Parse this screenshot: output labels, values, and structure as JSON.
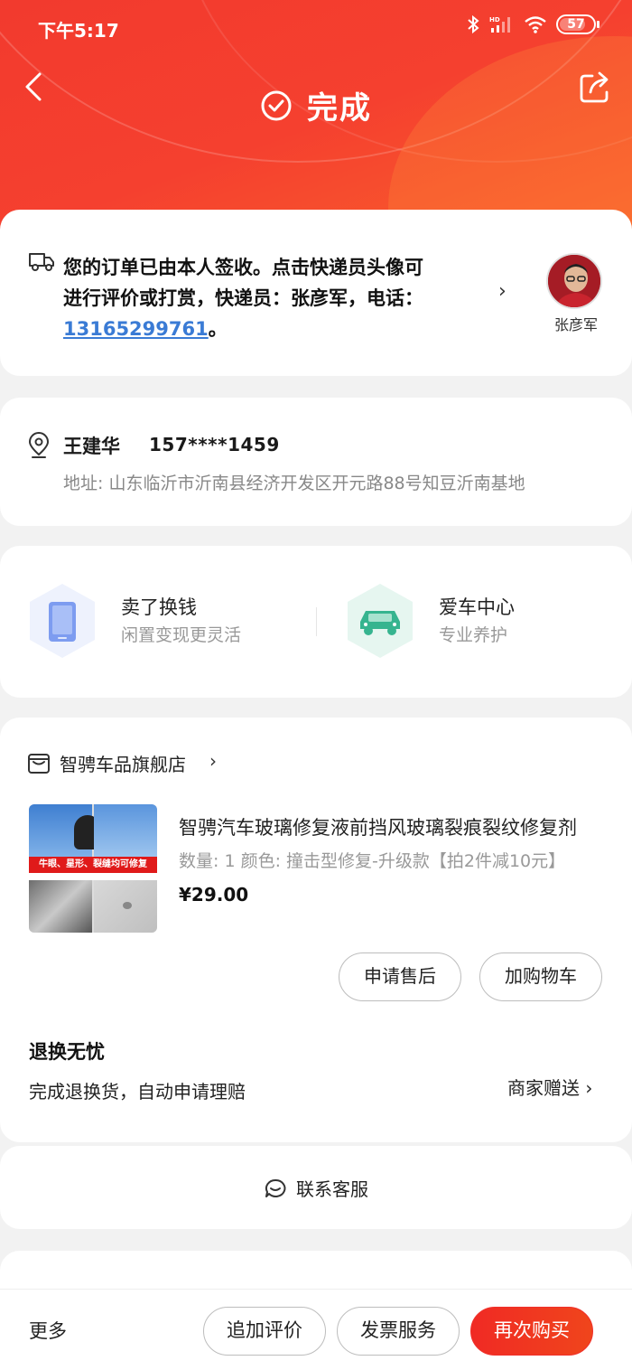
{
  "status_bar": {
    "time": "下午5:17",
    "battery": "57",
    "network": "HD"
  },
  "header": {
    "title": "完成"
  },
  "delivery": {
    "line1": "您的订单已由本人签收。点击快递员头像可",
    "line2": "进行评价或打赏，快递员：张彦军，电话：",
    "phone": "13165299761",
    "phone_suffix": "。",
    "chevron": "›",
    "courier_name": "张彦军"
  },
  "address": {
    "name": "王建华",
    "phone": "157****1459",
    "line": "地址: 山东临沂市沂南县经济开发区开元路88号知豆沂南基地"
  },
  "services": [
    {
      "title": "卖了换钱",
      "subtitle": "闲置变现更灵活",
      "icon": "phone-icon",
      "color": "#6f8fe8"
    },
    {
      "title": "爱车中心",
      "subtitle": "专业养护",
      "icon": "car-icon",
      "color": "#2fb58c"
    }
  ],
  "shop": {
    "name": "智骋车品旗舰店",
    "chevron": "›",
    "product": {
      "title": "智骋汽车玻璃修复液前挡风玻璃裂痕裂纹修复剂",
      "spec": "数量: 1   颜色: 撞击型修复-升级款【拍2件减10元】",
      "price": "¥29.00",
      "image_banner": "牛眼、星形、裂缝均可修复"
    },
    "btn_aftersale": "申请售后",
    "btn_addcart": "加购物车",
    "assure_title": "退换无忧",
    "assure_desc": "完成退换货，自动申请理赔",
    "assure_link": "商家赠送 ›"
  },
  "contact": {
    "label": "联系客服"
  },
  "bottom_bar": {
    "more": "更多",
    "review": "追加评价",
    "invoice": "发票服务",
    "rebuy": "再次购买"
  },
  "colors": {
    "accent": "#f23a2e",
    "link": "#3a7bd5"
  }
}
